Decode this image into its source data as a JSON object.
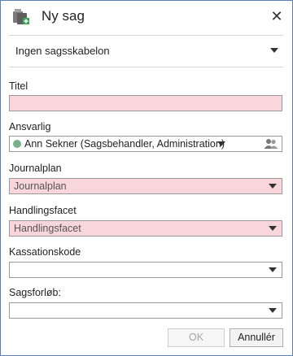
{
  "window": {
    "title": "Ny sag",
    "close_glyph": "✕"
  },
  "template": {
    "selected": "Ingen sagsskabelon"
  },
  "fields": {
    "titel": {
      "label": "Titel",
      "value": ""
    },
    "ansvarlig": {
      "label": "Ansvarlig",
      "value": "Ann Sekner (Sagsbehandler, Administration)"
    },
    "journalplan": {
      "label": "Journalplan",
      "placeholder": "Journalplan"
    },
    "handlingsfacet": {
      "label": "Handlingsfacet",
      "placeholder": "Handlingsfacet"
    },
    "kassationskode": {
      "label": "Kassationskode",
      "value": ""
    },
    "sagsforloeb": {
      "label": "Sagsforløb:",
      "value": ""
    }
  },
  "buttons": {
    "ok": "OK",
    "cancel": "Annullér"
  },
  "colors": {
    "required_bg": "#f9d6db",
    "status_dot": "#7bb08a",
    "border": "#5b7fb8"
  },
  "icons": {
    "app": "new-case-icon",
    "close": "close-icon",
    "people": "people-picker-icon",
    "dropdown": "chevron-down-icon"
  }
}
